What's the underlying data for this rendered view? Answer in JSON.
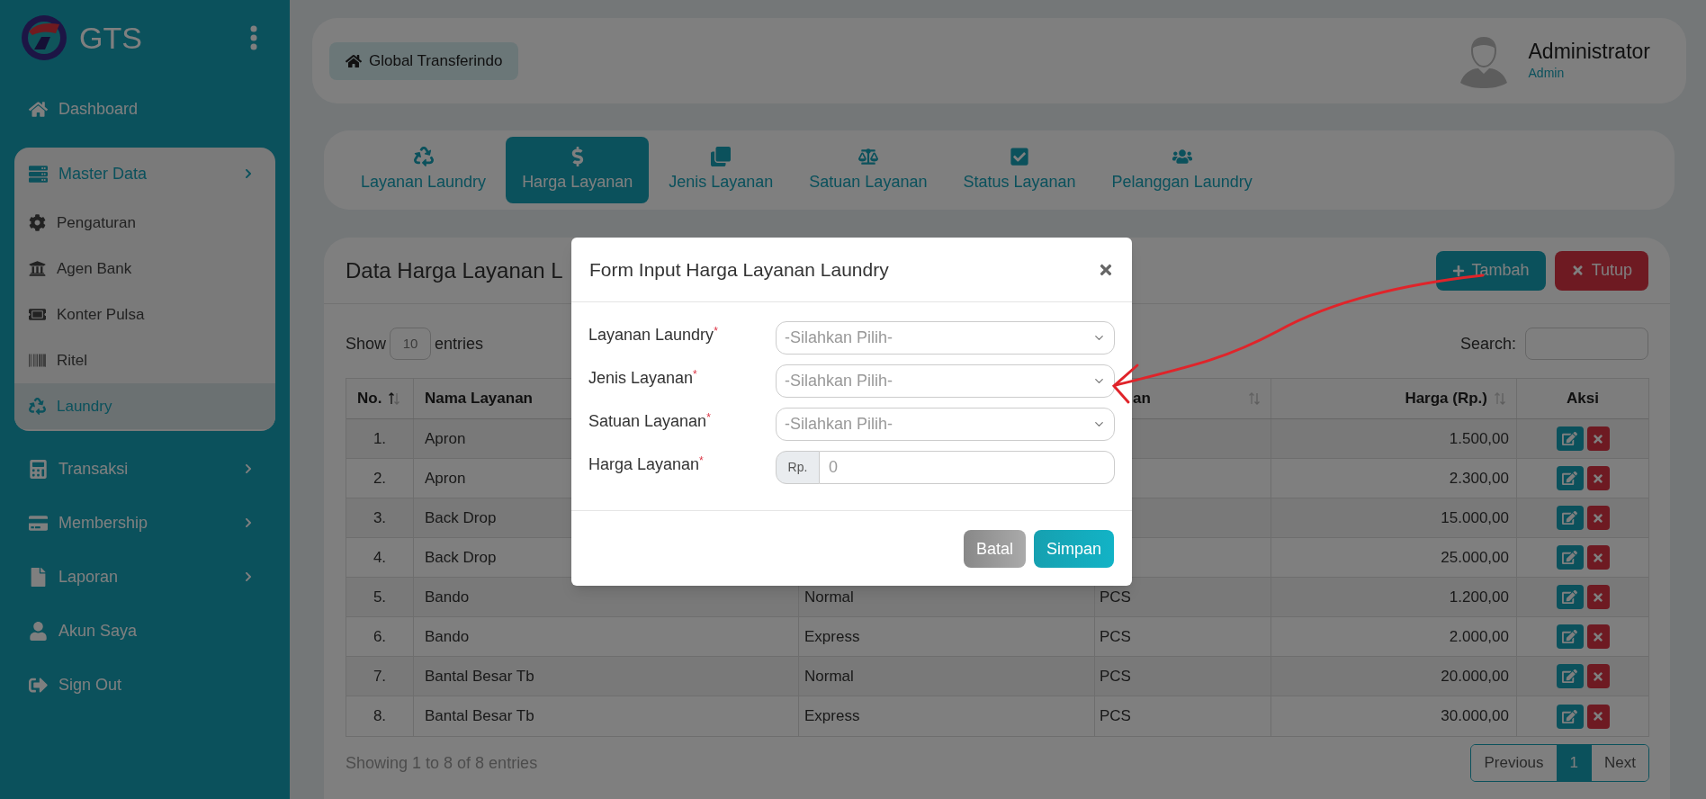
{
  "sidebar": {
    "brand": "GTS",
    "items": [
      {
        "label": "Dashboard",
        "expanded": false,
        "selected": false
      },
      {
        "label": "Master Data",
        "expanded": true,
        "selected": false,
        "children": [
          {
            "label": "Pengaturan",
            "selected": false
          },
          {
            "label": "Agen Bank",
            "selected": false
          },
          {
            "label": "Konter Pulsa",
            "selected": false
          },
          {
            "label": "Ritel",
            "selected": false
          },
          {
            "label": "Laundry",
            "selected": true
          }
        ]
      },
      {
        "label": "Transaksi",
        "expanded": false,
        "selected": false,
        "has_submenu": true
      },
      {
        "label": "Membership",
        "expanded": false,
        "selected": false,
        "has_submenu": true
      },
      {
        "label": "Laporan",
        "expanded": false,
        "selected": false,
        "has_submenu": true
      },
      {
        "label": "Akun Saya",
        "expanded": false,
        "selected": false
      },
      {
        "label": "Sign Out",
        "expanded": false,
        "selected": false
      }
    ]
  },
  "header": {
    "breadcrumb": "Global Transferindo",
    "user": {
      "name": "Administrator",
      "role": "Admin"
    }
  },
  "tabs": [
    {
      "label": "Layanan Laundry",
      "selected": false
    },
    {
      "label": "Harga Layanan",
      "selected": true
    },
    {
      "label": "Jenis Layanan",
      "selected": false
    },
    {
      "label": "Satuan Layanan",
      "selected": false
    },
    {
      "label": "Status Layanan",
      "selected": false
    },
    {
      "label": "Pelanggan Laundry",
      "selected": false
    }
  ],
  "panel": {
    "title": "Data Harga Layanan L",
    "buttons": [
      {
        "label": "Tambah",
        "kind": "add"
      },
      {
        "label": "Tutup",
        "kind": "close"
      }
    ],
    "show_label": "Show",
    "page_size": "10",
    "entries_label": "entries",
    "search_label": "Search:",
    "table": {
      "columns": [
        {
          "label": "No.",
          "sortable": true,
          "sorted": true
        },
        {
          "label": "Nama Layanan"
        },
        {
          "label": "an",
          "sortable": true,
          "sorted": false
        },
        {
          "label": "Harga (Rp.)",
          "sortable": true,
          "sorted": false
        },
        {
          "label": "Aksi"
        }
      ],
      "rows": [
        {
          "no": "1.",
          "nama_layanan": "Apron",
          "harga": "1.500,00"
        },
        {
          "no": "2.",
          "nama_layanan": "Apron",
          "harga": "2.300,00"
        },
        {
          "no": "3.",
          "nama_layanan": "Back Drop",
          "harga": "15.000,00"
        },
        {
          "no": "4.",
          "nama_layanan": "Back Drop",
          "harga": "25.000,00"
        },
        {
          "no": "5.",
          "nama_layanan": "Bando",
          "column_3": "Normal",
          "column_4": "PCS",
          "harga": "1.200,00"
        },
        {
          "no": "6.",
          "nama_layanan": "Bando",
          "column_3": "Express",
          "column_4": "PCS",
          "harga": "2.000,00"
        },
        {
          "no": "7.",
          "nama_layanan": "Bantal Besar Tb",
          "column_3": "Normal",
          "column_4": "PCS",
          "harga": "20.000,00"
        },
        {
          "no": "8.",
          "nama_layanan": "Bantal Besar Tb",
          "column_3": "Express",
          "column_4": "PCS",
          "harga": "30.000,00"
        }
      ]
    },
    "footer": "Showing 1 to 8 of 8 entries",
    "pagination": [
      {
        "label": "Previous",
        "selected": false
      },
      {
        "label": "1",
        "selected": true
      },
      {
        "label": "Next",
        "selected": false
      }
    ]
  },
  "modal": {
    "title": "Form Input Harga Layanan Laundry",
    "required_mark": "*",
    "fields": [
      {
        "label": "Layanan Laundry",
        "kind": "select",
        "placeholder": "-Silahkan Pilih-"
      },
      {
        "label": "Jenis Layanan",
        "kind": "select",
        "placeholder": "-Silahkan Pilih-"
      },
      {
        "label": "Satuan Layanan",
        "kind": "select",
        "placeholder": "-Silahkan Pilih-"
      },
      {
        "label": "Harga Layanan",
        "kind": "currency",
        "prefix": "Rp.",
        "placeholder": "0"
      }
    ],
    "buttons": [
      {
        "label": "Batal",
        "kind": "cancel"
      },
      {
        "label": "Simpan",
        "kind": "save"
      }
    ]
  }
}
